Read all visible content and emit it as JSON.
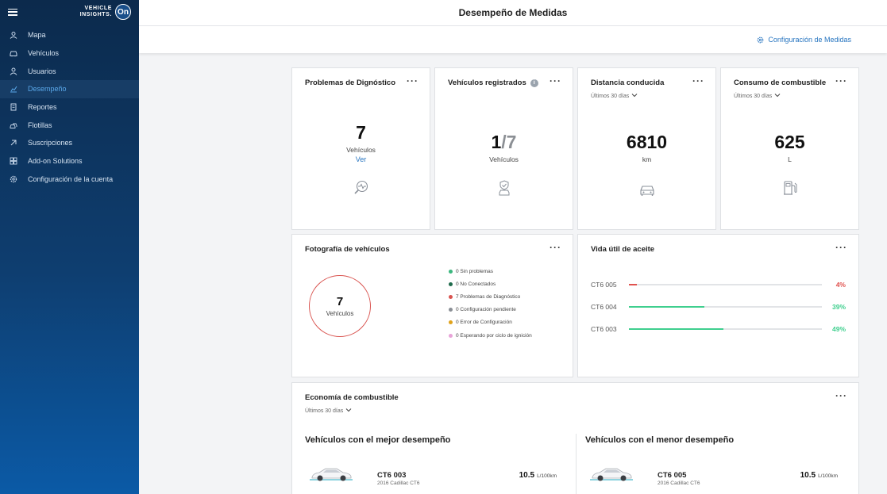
{
  "app": {
    "logo_line1": "VEHICLE",
    "logo_line2": "INSIGHTS.",
    "logo_badge": "On"
  },
  "sidebar": {
    "items": [
      {
        "label": "Mapa",
        "icon": "map-icon"
      },
      {
        "label": "Vehículos",
        "icon": "car-icon"
      },
      {
        "label": "Usuarios",
        "icon": "user-icon"
      },
      {
        "label": "Desempeño",
        "icon": "chart-icon",
        "active": true
      },
      {
        "label": "Reportes",
        "icon": "report-icon"
      },
      {
        "label": "Flotillas",
        "icon": "fleet-icon"
      },
      {
        "label": "Suscripciones",
        "icon": "subscription-icon"
      },
      {
        "label": "Add-on Solutions",
        "icon": "addon-icon"
      },
      {
        "label": "Configuración de la cuenta",
        "icon": "gear-icon"
      }
    ]
  },
  "header": {
    "title": "Desempeño de Medidas",
    "config_link": "Configuración de Medidas"
  },
  "cards": {
    "diagnostics": {
      "title": "Problemas de Dignóstico",
      "value": "7",
      "unit": "Vehículos",
      "link": "Ver"
    },
    "registered": {
      "title": "Vehículos registrados",
      "value_main": "1",
      "value_rest": "/7",
      "unit": "Vehículos"
    },
    "distance": {
      "title": "Distancia conducida",
      "period": "Últimos 30 días",
      "value": "6810",
      "unit": "km"
    },
    "fuel": {
      "title": "Consumo de combustible",
      "period": "Últimos 30 días",
      "value": "625",
      "unit": "L"
    }
  },
  "snapshot": {
    "title": "Fotografía de vehículos",
    "total": "7",
    "total_label": "Vehículos",
    "legend": [
      {
        "label": "0 Sin problemas",
        "color": "#3bb77e"
      },
      {
        "label": "0 No Conectados",
        "color": "#1f6b4c"
      },
      {
        "label": "7 Problemas de Diagnóstico",
        "color": "#d9534f"
      },
      {
        "label": "0 Configuración pendiente",
        "color": "#8a8f95"
      },
      {
        "label": "0 Error de Configuración",
        "color": "#e0a21b"
      },
      {
        "label": "0 Esperando por ciclo de ignición",
        "color": "#e8a3d8"
      }
    ]
  },
  "oil": {
    "title": "Vida útil de aceite",
    "rows": [
      {
        "name": "CT6 005",
        "pct_label": "4%",
        "fraction": 0.04,
        "color": "#e0524f"
      },
      {
        "name": "CT6 004",
        "pct_label": "39%",
        "fraction": 0.39,
        "color": "#3fcf8e"
      },
      {
        "name": "CT6 003",
        "pct_label": "49%",
        "fraction": 0.49,
        "color": "#3fcf8e"
      }
    ]
  },
  "economy": {
    "title": "Economía de combustible",
    "period": "Últimos 30 días",
    "best": {
      "heading": "Vehículos con el mejor desempeño",
      "name": "CT6 003",
      "model": "2016 Cadillac CT6",
      "value": "10.5",
      "unit": "L/100km"
    },
    "worst": {
      "heading": "Vehículos con el menor desempeño",
      "name": "CT6 005",
      "model": "2016 Cadillac CT6",
      "value": "10.5",
      "unit": "L/100km"
    }
  },
  "colors": {
    "accent": "#2775c0",
    "sidebar_dark": "#0c2a4c",
    "sidebar_light": "#0b5aa6",
    "danger": "#d9534f",
    "success": "#3fcf8e"
  }
}
